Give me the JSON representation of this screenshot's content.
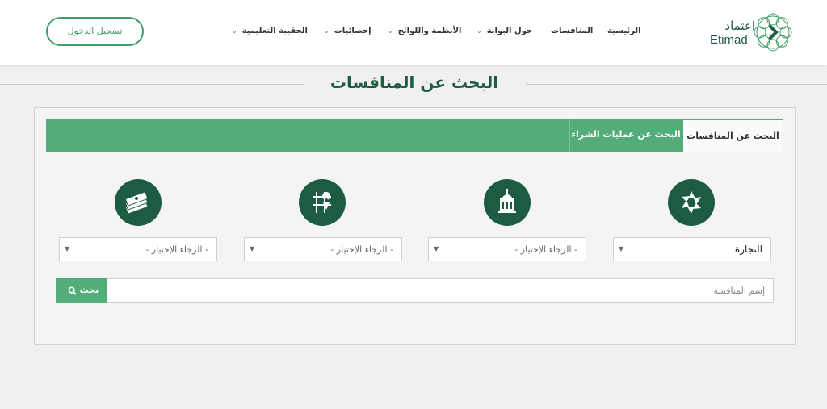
{
  "header": {
    "logo": {
      "arabic": "اعتماد",
      "latin": "Etimad"
    },
    "nav": [
      {
        "label": "الرئيسية",
        "has_dropdown": false
      },
      {
        "label": "المنافسات",
        "has_dropdown": false
      },
      {
        "label": "حول البوابة",
        "has_dropdown": true
      },
      {
        "label": "الأنظمة واللوائح",
        "has_dropdown": true
      },
      {
        "label": "إحصائيات",
        "has_dropdown": true
      },
      {
        "label": "الحقيبة التعليمية",
        "has_dropdown": true
      }
    ],
    "login_label": "تسجيل الدخول"
  },
  "page_title": "البحث عن المنافسات",
  "tabs": [
    {
      "label": "البحث عن المنافسات",
      "active": true
    },
    {
      "label": "البحث عن عمليات الشراء",
      "active": false
    }
  ],
  "filters": [
    {
      "icon": "aperture-icon",
      "selected": "التجارة"
    },
    {
      "icon": "building-icon",
      "selected": "- الرجاء الإختيار -"
    },
    {
      "icon": "map-pin-icon",
      "selected": "- الرجاء الإختيار -"
    },
    {
      "icon": "money-stack-icon",
      "selected": "- الرجاء الإختيار -"
    }
  ],
  "search": {
    "placeholder": "إسم المنافسة",
    "button_label": "بحث"
  },
  "colors": {
    "brand_dark": "#1d5c42",
    "brand_green": "#52ad78",
    "accent": "#3f9e68"
  }
}
